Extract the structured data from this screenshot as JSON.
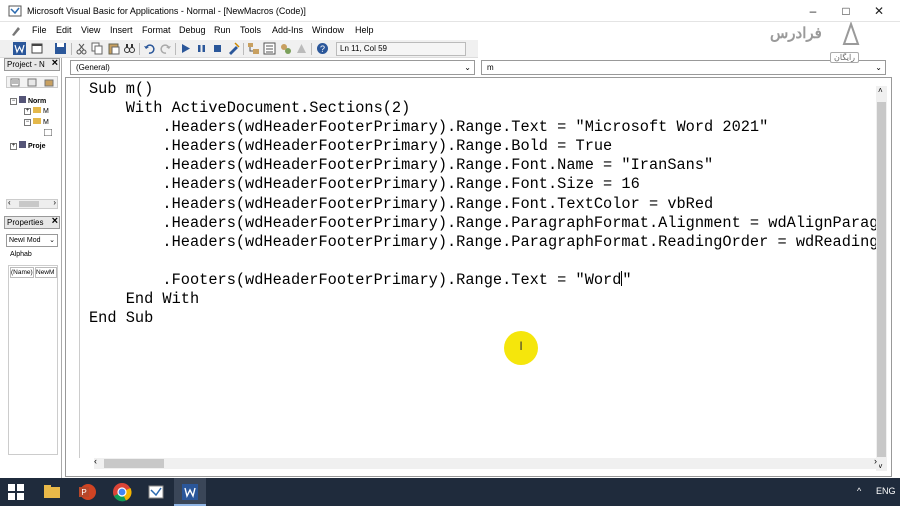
{
  "window": {
    "title": "Microsoft Visual Basic for Applications - Normal - [NewMacros (Code)]",
    "minimize": "–",
    "maximize": "□",
    "close": "✕"
  },
  "menu": [
    "File",
    "Edit",
    "View",
    "Insert",
    "Format",
    "Debug",
    "Run",
    "Tools",
    "Add-Ins",
    "Window",
    "Help"
  ],
  "status": {
    "position": "Ln 11, Col 59"
  },
  "project_pane": {
    "title": "Project - N",
    "tree": [
      "Norm",
      "M",
      "M",
      "Proje"
    ]
  },
  "properties_pane": {
    "title": "Properties",
    "object_combo": "NewI Mod",
    "tab": "Alphab",
    "name_key": "(Name)",
    "name_val": "NewM"
  },
  "editor": {
    "object_combo": "(General)",
    "proc_combo": "m",
    "code_lines": [
      "Sub m()",
      "    With ActiveDocument.Sections(2)",
      "        .Headers(wdHeaderFooterPrimary).Range.Text = \"Microsoft Word 2021\"",
      "        .Headers(wdHeaderFooterPrimary).Range.Bold = True",
      "        .Headers(wdHeaderFooterPrimary).Range.Font.Name = \"IranSans\"",
      "        .Headers(wdHeaderFooterPrimary).Range.Font.Size = 16",
      "        .Headers(wdHeaderFooterPrimary).Range.Font.TextColor = vbRed",
      "        .Headers(wdHeaderFooterPrimary).Range.ParagraphFormat.Alignment = wdAlignParagraphCenter",
      "        .Headers(wdHeaderFooterPrimary).Range.ParagraphFormat.ReadingOrder = wdReadingOrderRtl",
      "",
      "        .Footers(wdHeaderFooterPrimary).Range.Text = \"Word",
      "\"",
      "    End With",
      "End Sub"
    ]
  },
  "watermark": {
    "text": "فرادرس",
    "sub": "رایگان"
  },
  "taskbar": {
    "lang": "ENG",
    "chevron": "^"
  },
  "colors": {
    "taskbar": "#1f2b3c",
    "cursor_highlight": "#f5e60c"
  }
}
